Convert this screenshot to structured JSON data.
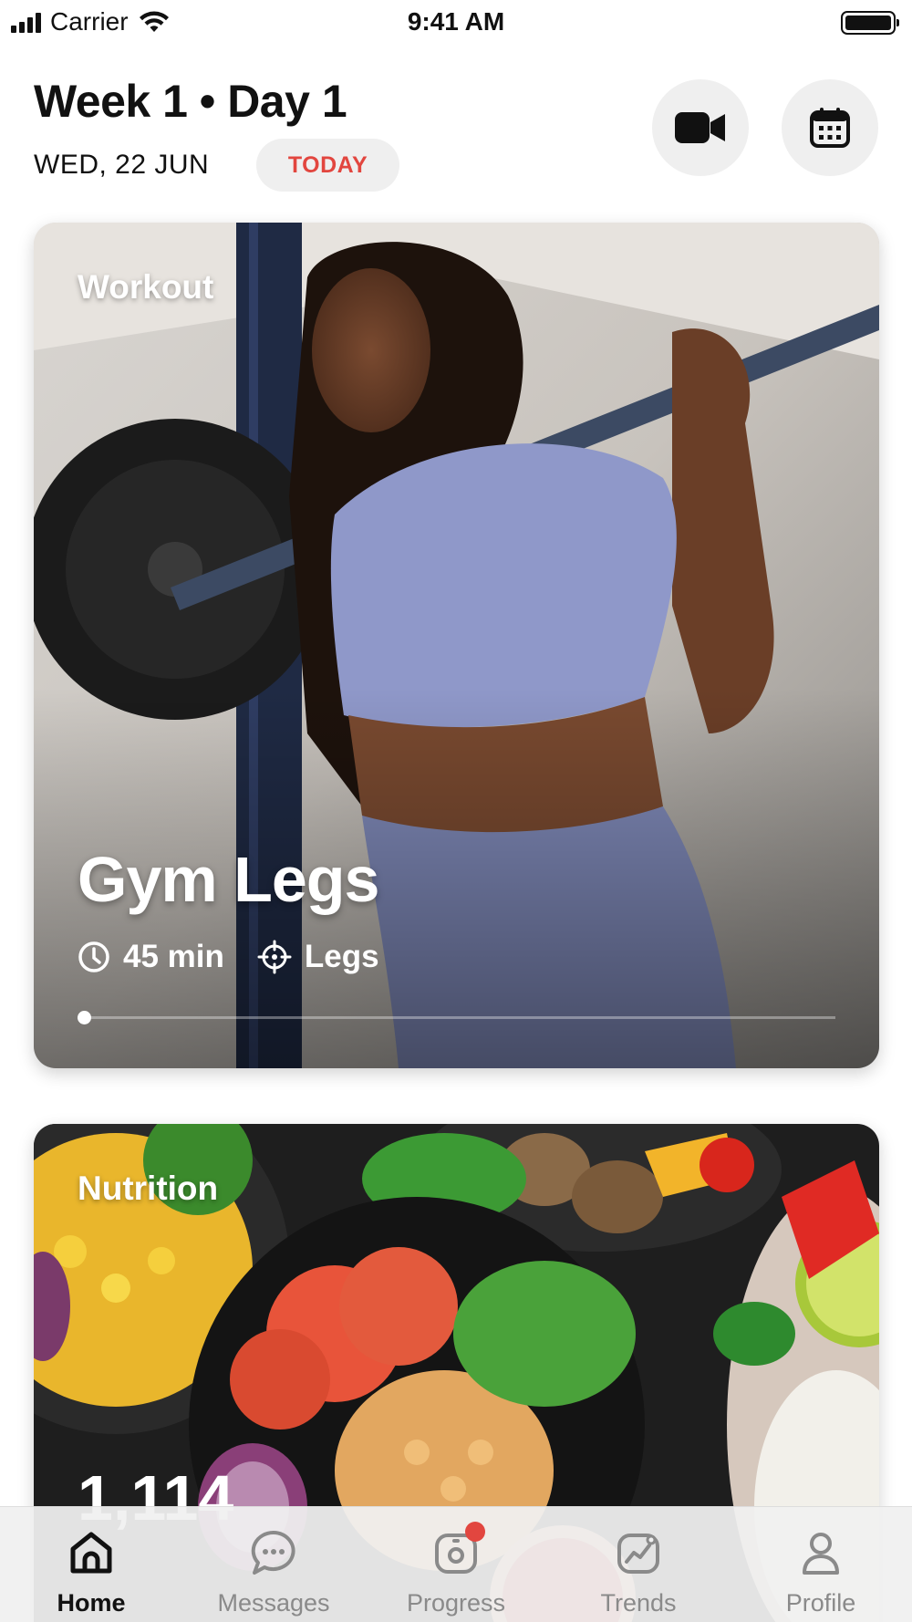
{
  "status_bar": {
    "carrier": "Carrier",
    "time": "9:41 AM"
  },
  "header": {
    "title": "Week 1 • Day 1",
    "date": "WED, 22 JUN",
    "today_badge": "TODAY",
    "video_button_icon": "video-camera-icon",
    "calendar_button_icon": "calendar-icon"
  },
  "cards": {
    "workout": {
      "label": "Workout",
      "title": "Gym Legs",
      "duration": "45 min",
      "duration_icon": "clock-icon",
      "target": "Legs",
      "target_icon": "crosshair-icon",
      "progress_fraction": 0.0
    },
    "nutrition": {
      "label": "Nutrition",
      "value_partial": "1,114"
    }
  },
  "tab_bar": {
    "items": [
      {
        "label": "Home",
        "icon": "home-icon",
        "active": true
      },
      {
        "label": "Messages",
        "icon": "chat-bubble-icon",
        "active": false
      },
      {
        "label": "Progress",
        "icon": "camera-progress-icon",
        "active": false,
        "badge": true
      },
      {
        "label": "Trends",
        "icon": "trend-chart-icon",
        "active": false
      },
      {
        "label": "Profile",
        "icon": "person-icon",
        "active": false
      }
    ]
  },
  "colors": {
    "accent_red": "#e2463f",
    "pill_background": "#efefef",
    "text_primary": "#111111",
    "tab_inactive": "#8a8a8a"
  }
}
